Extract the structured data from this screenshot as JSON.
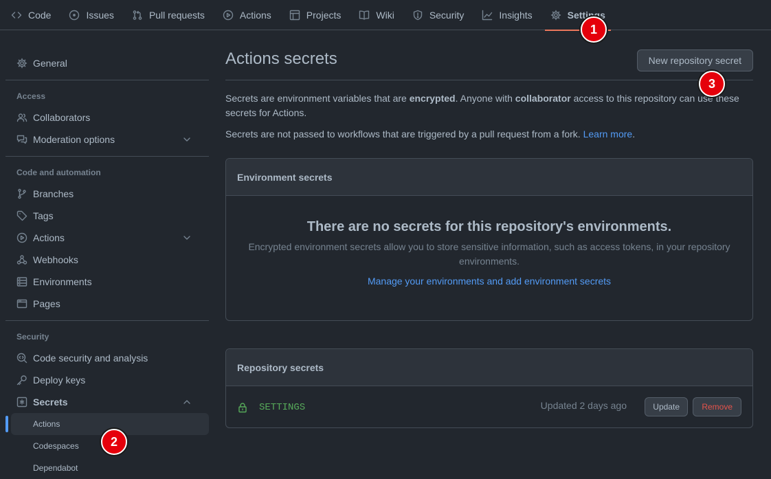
{
  "nav": {
    "tabs": [
      {
        "label": "Code",
        "icon": "code-icon"
      },
      {
        "label": "Issues",
        "icon": "issue-icon"
      },
      {
        "label": "Pull requests",
        "icon": "pull-request-icon"
      },
      {
        "label": "Actions",
        "icon": "play-icon"
      },
      {
        "label": "Projects",
        "icon": "table-icon"
      },
      {
        "label": "Wiki",
        "icon": "book-icon"
      },
      {
        "label": "Security",
        "icon": "shield-icon"
      },
      {
        "label": "Insights",
        "icon": "graph-icon"
      },
      {
        "label": "Settings",
        "icon": "gear-icon",
        "active": true
      }
    ],
    "accent": "#ec775c"
  },
  "sidebar": {
    "general": "General",
    "access_heading": "Access",
    "collaborators": "Collaborators",
    "moderation": "Moderation options",
    "code_heading": "Code and automation",
    "branches": "Branches",
    "tags": "Tags",
    "actions": "Actions",
    "webhooks": "Webhooks",
    "environments": "Environments",
    "pages": "Pages",
    "security_heading": "Security",
    "code_security": "Code security and analysis",
    "deploy_keys": "Deploy keys",
    "secrets": "Secrets",
    "secrets_actions": "Actions",
    "secrets_codespaces": "Codespaces",
    "secrets_dependabot": "Dependabot"
  },
  "main": {
    "title": "Actions secrets",
    "new_button": "New repository secret",
    "desc_part1": "Secrets are environment variables that are ",
    "desc_bold1": "encrypted",
    "desc_part2": ". Anyone with ",
    "desc_bold2": "collaborator",
    "desc_part3": " access to this repository can use these secrets for Actions.",
    "desc2_text": "Secrets are not passed to workflows that are triggered by a pull request from a fork. ",
    "desc2_link": "Learn more",
    "desc2_end": "."
  },
  "environment_secrets": {
    "heading": "Environment secrets",
    "empty_title": "There are no secrets for this repository's environments.",
    "empty_text": "Encrypted environment secrets allow you to store sensitive information, such as access tokens, in your repository environments.",
    "link": "Manage your environments and add environment secrets"
  },
  "repository_secrets": {
    "heading": "Repository secrets",
    "rows": [
      {
        "name": "SETTINGS",
        "updated": "Updated 2 days ago",
        "update_label": "Update",
        "remove_label": "Remove"
      }
    ]
  },
  "markers": {
    "one": "1",
    "two": "2",
    "three": "3"
  },
  "colors": {
    "background": "#22272e",
    "link": "#539bf5",
    "danger": "#e5534b",
    "success": "#57ab5a",
    "marker": "#e5000b"
  }
}
